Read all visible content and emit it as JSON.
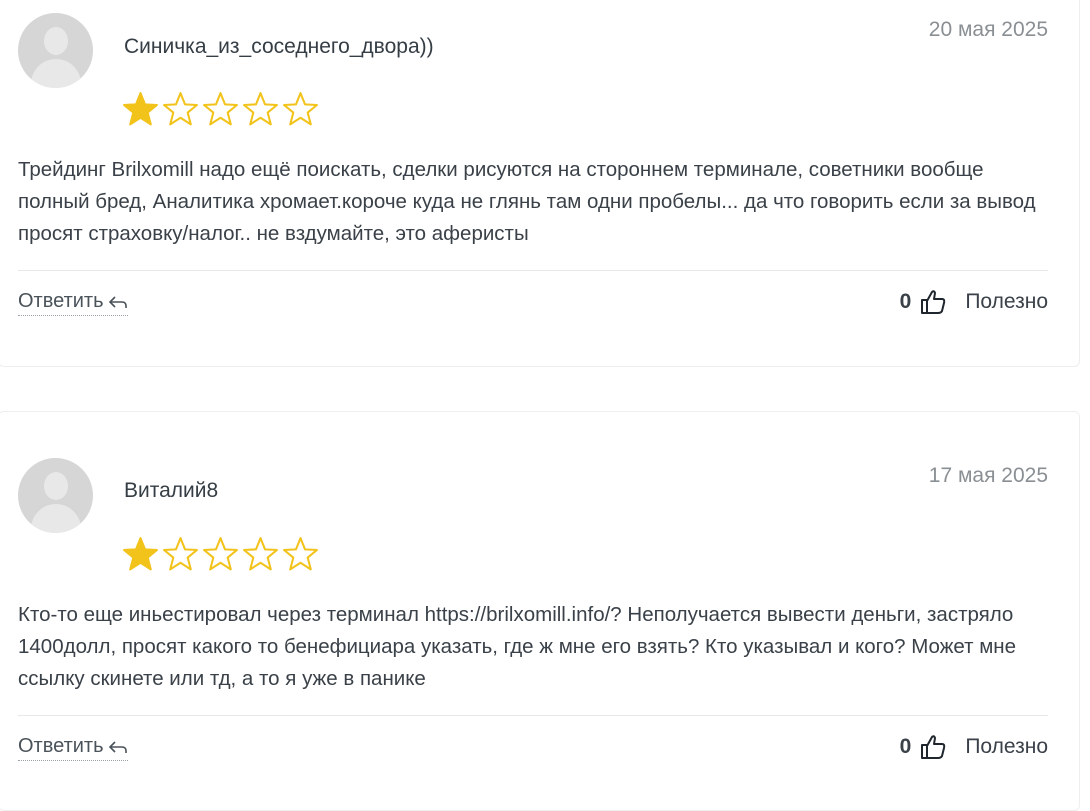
{
  "reviews": [
    {
      "author": "Синичка_из_соседнего_двора))",
      "date": "20 мая 2025",
      "rating": 1,
      "max_rating": 5,
      "text": "Трейдинг Brilxomill надо ещё поискать, сделки рисуются на стороннем терминале, советники вообще полный бред, Аналитика хромает.короче куда не глянь там одни пробелы... да что говорить если за вывод просят страховку/налог.. не вздумайте, это аферисты",
      "reply_label": "Ответить",
      "likes": "0",
      "useful_label": "Полезно"
    },
    {
      "author": "Виталий8",
      "date": "17 мая 2025",
      "rating": 1,
      "max_rating": 5,
      "text": "Кто-то еще иньестировал через терминал https://brilxomill.info/? Неполучается вывести деньги, застряло 1400долл, просят какого то бенефициара указать, где ж мне его взять? Кто указывал и кого? Может мне ссылку скинете или тд, а то я уже в панике",
      "reply_label": "Ответить",
      "likes": "0",
      "useful_label": "Полезно"
    }
  ],
  "colors": {
    "star": "#f2c31b",
    "avatar": "#d6d6d6",
    "date": "#8a8f94"
  },
  "icons": [
    "user-avatar-icon",
    "star-icon",
    "reply-arrow-icon",
    "thumbs-up-icon"
  ]
}
